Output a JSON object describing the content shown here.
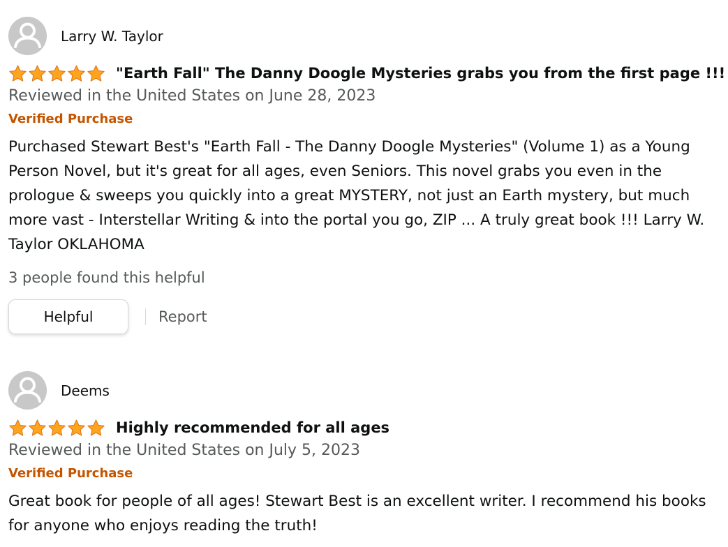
{
  "colors": {
    "star_fill": "#FFA41C",
    "star_stroke": "#DE7921",
    "verified": "#C45500",
    "secondary_text": "#565959",
    "primary_text": "#0F1111",
    "avatar_bg": "#C8C8C8"
  },
  "icons": {
    "avatar": "default-profile-icon",
    "star": "star-icon"
  },
  "reviews": [
    {
      "profile_name": "Larry W. Taylor",
      "rating": 5,
      "title": "\"Earth Fall\" The Danny Doogle Mysteries grabs you from the first page !!!",
      "date": "Reviewed in the United States on June 28, 2023",
      "verified": "Verified Purchase",
      "body": "Purchased Stewart Best's \"Earth Fall - The Danny Doogle Mysteries\" (Volume 1) as a Young Person Novel, but it's great for all ages, even Seniors. This novel grabs you even in the prologue & sweeps you quickly into a great MYSTERY, not just an Earth mystery, but much more vast - Interstellar Writing & into the portal you go, ZIP ... A truly great book !!! Larry W. Taylor OKLAHOMA",
      "helpful_count": "3 people found this helpful",
      "helpful_button": "Helpful",
      "report_link": "Report"
    },
    {
      "profile_name": "Deems",
      "rating": 5,
      "title": "Highly recommended for all ages",
      "date": "Reviewed in the United States on July 5, 2023",
      "verified": "Verified Purchase",
      "body": "Great book for people of all ages! Stewart Best is an excellent writer. I recommend his books for anyone who enjoys reading the truth!"
    }
  ]
}
